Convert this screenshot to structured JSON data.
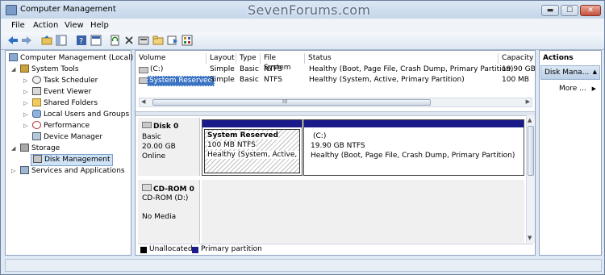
{
  "window": {
    "title": "Computer Management",
    "watermark": "SevenForums.com",
    "min_label": "▬",
    "max_label": "☐",
    "close_label": "✕"
  },
  "menu": [
    "File",
    "Action",
    "View",
    "Help"
  ],
  "toolbar_icons": [
    "back-arrow-icon",
    "forward-arrow-icon",
    "up-folder-icon",
    "show-hide-tree-icon",
    "help-icon",
    "console-icon",
    "refresh-icon",
    "delete-icon",
    "properties-icon",
    "open-folder-icon",
    "export-icon",
    "settings-icon"
  ],
  "tree": {
    "root": "Computer Management (Local)",
    "system_tools": "System Tools",
    "task_scheduler": "Task Scheduler",
    "event_viewer": "Event Viewer",
    "shared_folders": "Shared Folders",
    "local_users": "Local Users and Groups",
    "performance": "Performance",
    "device_manager": "Device Manager",
    "storage": "Storage",
    "disk_management": "Disk Management",
    "services": "Services and Applications"
  },
  "volumes": {
    "headers": [
      "Volume",
      "Layout",
      "Type",
      "File System",
      "Status",
      "Capacity"
    ],
    "rows": [
      [
        "(C:)",
        "Simple",
        "Basic",
        "NTFS",
        "Healthy (Boot, Page File, Crash Dump, Primary Partition)",
        "19.90 GB"
      ],
      [
        "System Reserved",
        "Simple",
        "Basic",
        "NTFS",
        "Healthy (System, Active, Primary Partition)",
        "100 MB"
      ]
    ]
  },
  "hscroll_grip": "III",
  "disk0": {
    "name": "Disk 0",
    "type": "Basic",
    "size": "20.00 GB",
    "status": "Online",
    "p1_name": "System Reserved",
    "p1_size": "100 MB NTFS",
    "p1_status": "Healthy (System, Active, Pri",
    "p2_name": "(C:)",
    "p2_size": "19.90 GB NTFS",
    "p2_status": "Healthy (Boot, Page File, Crash Dump, Primary Partition)"
  },
  "cdrom": {
    "name": "CD-ROM 0",
    "type": "CD-ROM (D:)",
    "media": "No Media"
  },
  "legend": {
    "unallocated": "Unallocated",
    "primary": "Primary partition",
    "unallocated_color": "#000000",
    "primary_color": "#1a1a8a"
  },
  "actions": {
    "header": "Actions",
    "section": "Disk Mana...",
    "more": "More ..."
  }
}
